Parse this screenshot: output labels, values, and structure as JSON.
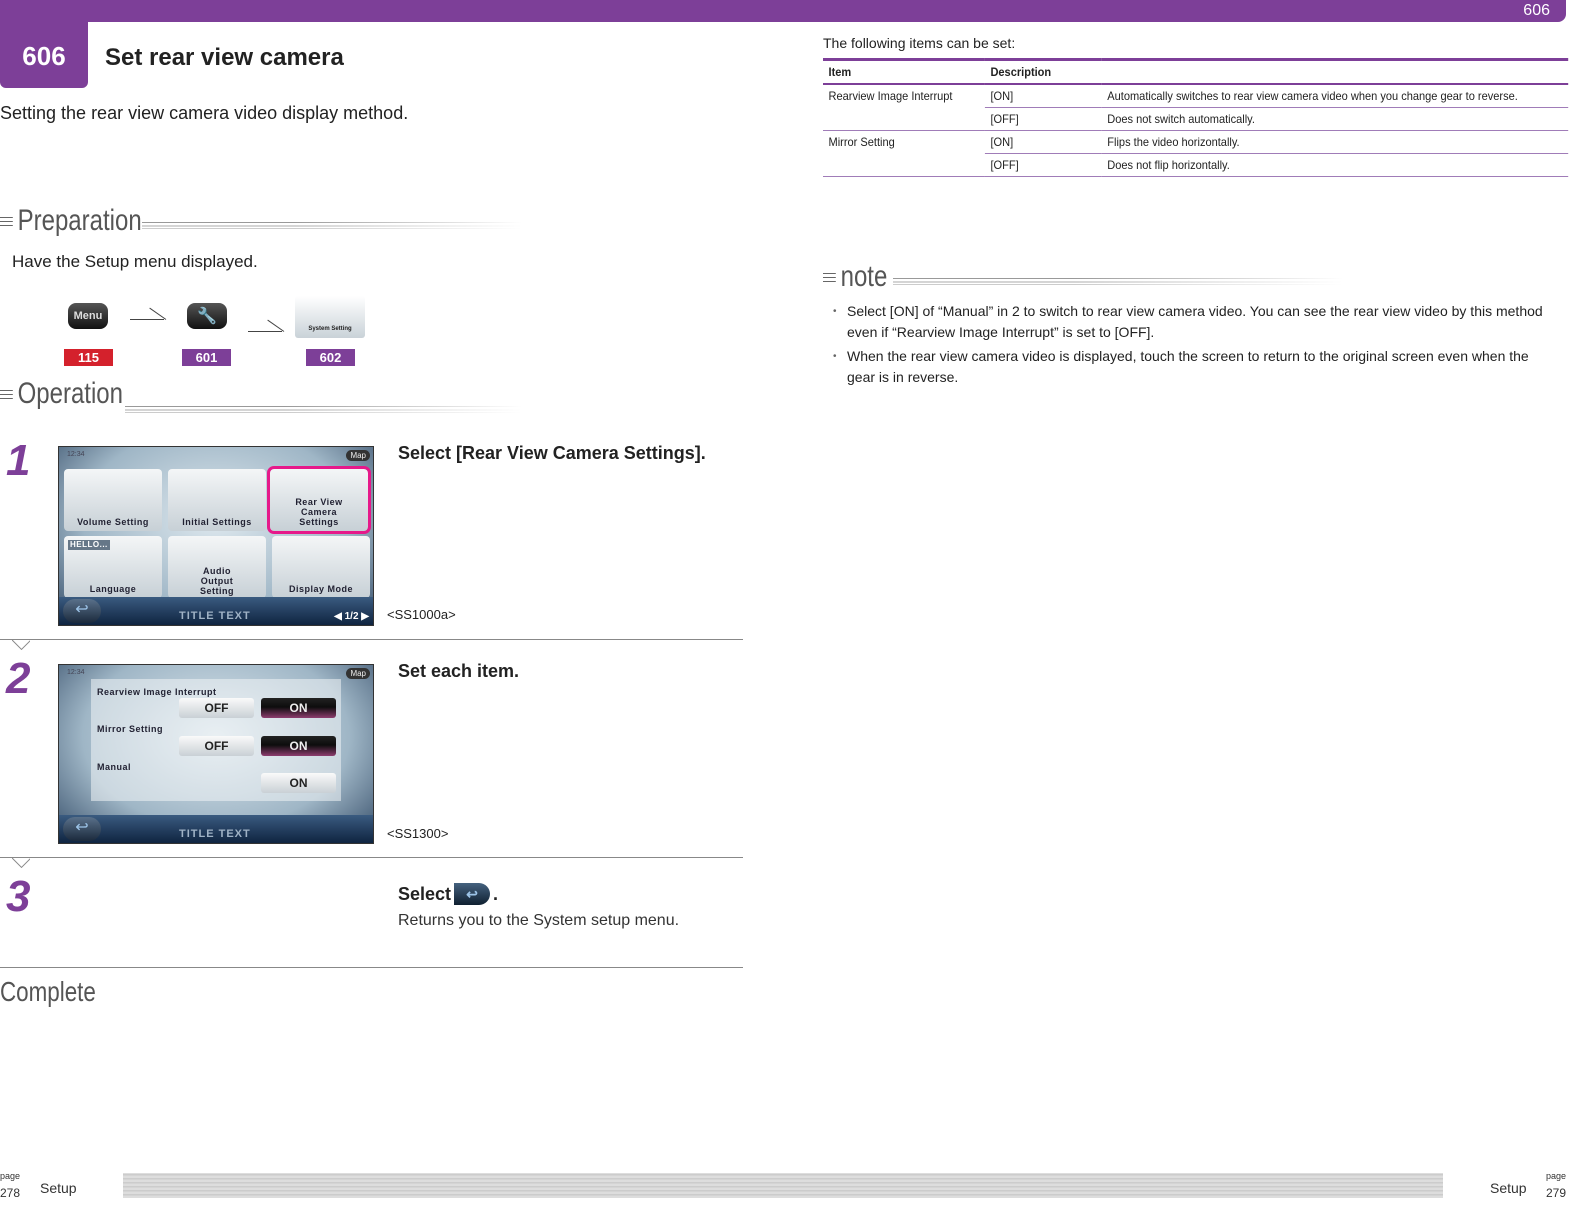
{
  "header": {
    "section_number": "606",
    "title": "Set rear view camera",
    "intro": "Setting the rear view camera video display method.",
    "colors": {
      "accent": "#7d3f98",
      "red_badge": "#d4212c",
      "highlight": "#e6198a"
    }
  },
  "preparation": {
    "heading": "Preparation",
    "text": "Have the Setup menu displayed.",
    "path": [
      {
        "icon": "menu-button",
        "label": "Menu",
        "page": "115"
      },
      {
        "icon": "wrench-icon",
        "page": "601"
      },
      {
        "icon": "system-setting-icon",
        "label": "System Setting",
        "page": "602"
      }
    ]
  },
  "operation": {
    "heading": "Operation",
    "steps": [
      {
        "number": "1",
        "instruction": "Select [Rear View Camera Settings].",
        "screen_code": "<SS1000a>",
        "screen": {
          "clock": "12:34",
          "map": "Map",
          "title": "TITLE TEXT",
          "page": "1/2",
          "tiles": [
            "Volume Setting",
            "Initial Settings",
            "Rear View Camera Settings",
            "Language",
            "Audio Output Setting",
            "Display Mode"
          ],
          "hello": "HELLO..."
        }
      },
      {
        "number": "2",
        "instruction": "Set each item.",
        "screen_code": "<SS1300>",
        "screen": {
          "clock": "12:34",
          "map": "Map",
          "title": "TITLE TEXT",
          "rows": [
            {
              "label": "Rearview Image Interrupt",
              "off": "OFF",
              "on": "ON"
            },
            {
              "label": "Mirror Setting",
              "off": "OFF",
              "on": "ON"
            },
            {
              "label": "Manual",
              "on": "ON"
            }
          ]
        }
      },
      {
        "number": "3",
        "instruction_prefix": "Select",
        "instruction_suffix": ".",
        "icon": "back-arrow-icon",
        "detail": "Returns you to the System setup menu."
      }
    ],
    "complete": "Complete"
  },
  "settings_table": {
    "intro": "The following items can be set:",
    "headers": [
      "Item",
      "Description"
    ],
    "rows": [
      {
        "item": "Rearview Image Interrupt",
        "value": "[ON]",
        "description": "Automatically switches to rear view camera video when you change gear to reverse."
      },
      {
        "item": "",
        "value": "[OFF]",
        "description": "Does not switch automatically."
      },
      {
        "item": "Mirror Setting",
        "value": "[ON]",
        "description": "Flips the video horizontally."
      },
      {
        "item": "",
        "value": "[OFF]",
        "description": "Does not flip horizontally."
      }
    ]
  },
  "note": {
    "heading": "note",
    "items": [
      "Select [ON] of “Manual” in 2 to switch to rear view camera video. You can see the rear view video by this method even if “Rearview Image Interrupt” is set to [OFF].",
      "When the rear view camera video is displayed, touch the screen to return to the original screen even when the gear is in reverse."
    ]
  },
  "footer": {
    "page_word": "page",
    "left_page": "278",
    "right_page": "279",
    "left_section": "Setup",
    "right_section": "Setup"
  }
}
